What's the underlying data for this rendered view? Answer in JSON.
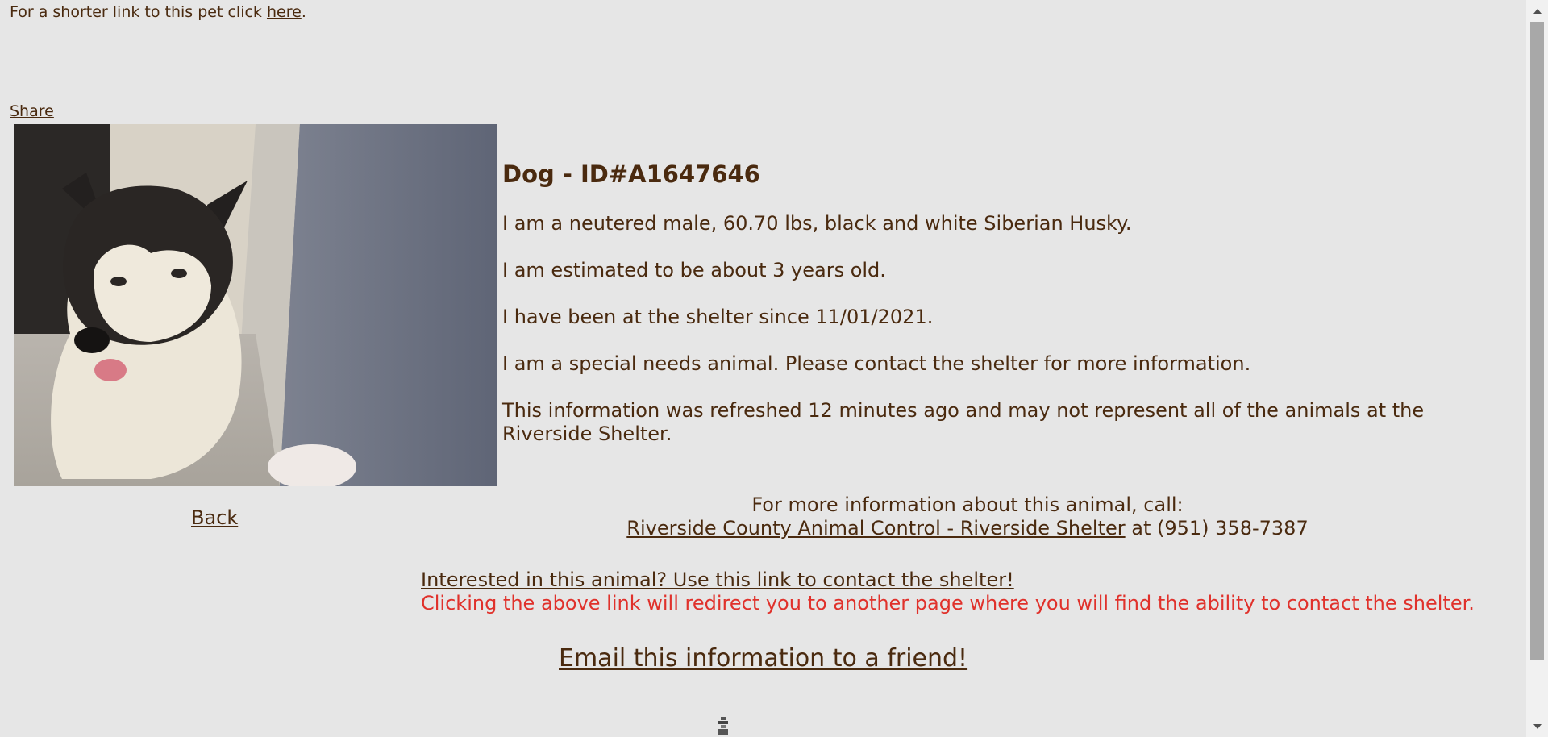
{
  "top_line": {
    "prefix": "For a shorter link to this pet click ",
    "link_label": "here",
    "suffix": "."
  },
  "share_label": "Share",
  "animal": {
    "title": "Dog - ID#A1647646",
    "description": "I am a neutered male, 60.70 lbs, black and white Siberian Husky.",
    "age": "I am estimated to be about 3 years old.",
    "since": "I have been at the shelter since 11/01/2021.",
    "special_needs": "I am a special needs animal. Please contact the shelter for more information.",
    "refresh_note": "This information was refreshed 12 minutes ago and may not represent all of the animals at the Riverside Shelter."
  },
  "back_label": "Back",
  "contact": {
    "intro": "For more information about this animal, call:",
    "shelter_link": "Riverside County Animal Control - Riverside Shelter",
    "phone_text": " at (951) 358-7387"
  },
  "interest": {
    "link_label": "Interested in this animal? Use this link to contact the shelter!",
    "warning": "Clicking the above link will redirect you to another page where you will find the ability to contact the shelter."
  },
  "email_label": "Email this information to a friend!",
  "icons": {
    "photo": "husky-photo",
    "loader": "loading-icon",
    "scroll_up": "scroll-up-icon",
    "scroll_down": "scroll-down-icon"
  },
  "colors": {
    "text": "#4a2a0f",
    "warning": "#e0312b",
    "background": "#e6e6e6"
  }
}
